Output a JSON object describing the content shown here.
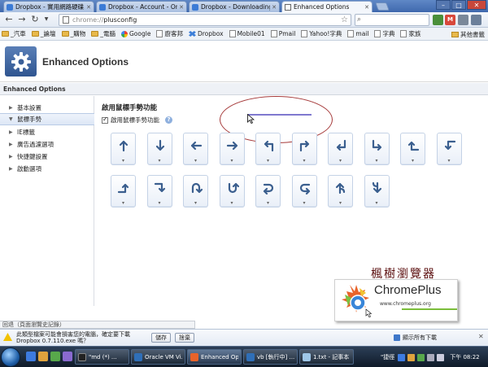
{
  "browser": {
    "tabs": [
      {
        "title": "Dropbox - 實用網路硬碟...",
        "icon": "dropbox-icon",
        "active": false
      },
      {
        "title": "Dropbox - Account - Online...",
        "icon": "dropbox-icon",
        "active": false
      },
      {
        "title": "Dropbox - Downloading Dr...",
        "icon": "dropbox-icon",
        "active": false
      },
      {
        "title": "Enhanced Options",
        "icon": "page-icon",
        "active": true
      }
    ],
    "address": {
      "scheme": "chrome://",
      "path": "plusconfig"
    },
    "bookmarks": [
      "_汽車",
      "_論壇",
      "_購物",
      "_電腦",
      "Google",
      "廚客邦",
      "Dropbox",
      "Mobile01",
      "Pmail",
      "Yahoo!字典",
      "mail",
      "字典",
      "家族"
    ],
    "other_bookmarks": "其他書籤"
  },
  "page": {
    "title": "Enhanced Options",
    "breadcrumb": "Enhanced Options"
  },
  "sidebar": {
    "items": [
      {
        "label": "基本設置",
        "active": false
      },
      {
        "label": "鼠標手勢",
        "active": true
      },
      {
        "label": "IE標籤",
        "active": false
      },
      {
        "label": "廣告過濾選項",
        "active": false
      },
      {
        "label": "快捷鍵設置",
        "active": false
      },
      {
        "label": "啟動選項",
        "active": false
      }
    ]
  },
  "main": {
    "section_title": "啟用鼠標手勢功能",
    "checkbox_label": "啟用鼠標手勢功能",
    "checkbox_checked": true,
    "info_glyph": "?",
    "gestures": [
      {
        "icon": "arrow-up-icon"
      },
      {
        "icon": "arrow-down-icon"
      },
      {
        "icon": "arrow-left-icon"
      },
      {
        "icon": "arrow-right-icon"
      },
      {
        "icon": "up-then-left-icon"
      },
      {
        "icon": "up-then-right-icon"
      },
      {
        "icon": "down-then-left-icon"
      },
      {
        "icon": "down-then-right-icon"
      },
      {
        "icon": "left-then-up-icon"
      },
      {
        "icon": "left-then-down-icon"
      },
      {
        "icon": "right-then-up-icon"
      },
      {
        "icon": "right-then-down-icon"
      },
      {
        "icon": "up-down-loop-icon"
      },
      {
        "icon": "down-up-loop-icon"
      },
      {
        "icon": "right-left-loop-icon"
      },
      {
        "icon": "left-right-loop-icon"
      },
      {
        "icon": "up-with-hook-icon"
      },
      {
        "icon": "down-with-hook-icon"
      }
    ]
  },
  "promo": {
    "title": "楓樹瀏覽器",
    "name": "ChromePlus",
    "url": "www.chromeplus.org"
  },
  "status": {
    "text": "回退（頁面瀏覽史記錄）"
  },
  "download": {
    "warning": "此類型檔案可能會損害您的電腦，確定要下載 Dropbox 0.7.110.exe 嗎？",
    "save": "儲存",
    "discard": "捨棄",
    "show_all": "顯示所有下載"
  },
  "taskbar": {
    "tasks": [
      "\"md (*) ...",
      "Oracle VM Vi...",
      "Enhanced Opt...",
      "vb [執行中] ...",
      "1.txt - 記事本"
    ],
    "search": "\"捷徑",
    "clock": "下午 08:22"
  },
  "colors": {
    "accent": "#3f68ad",
    "gear": "#2f5590",
    "gesture_stroke": "#7f79cf",
    "annotation": "#a63b3b"
  }
}
